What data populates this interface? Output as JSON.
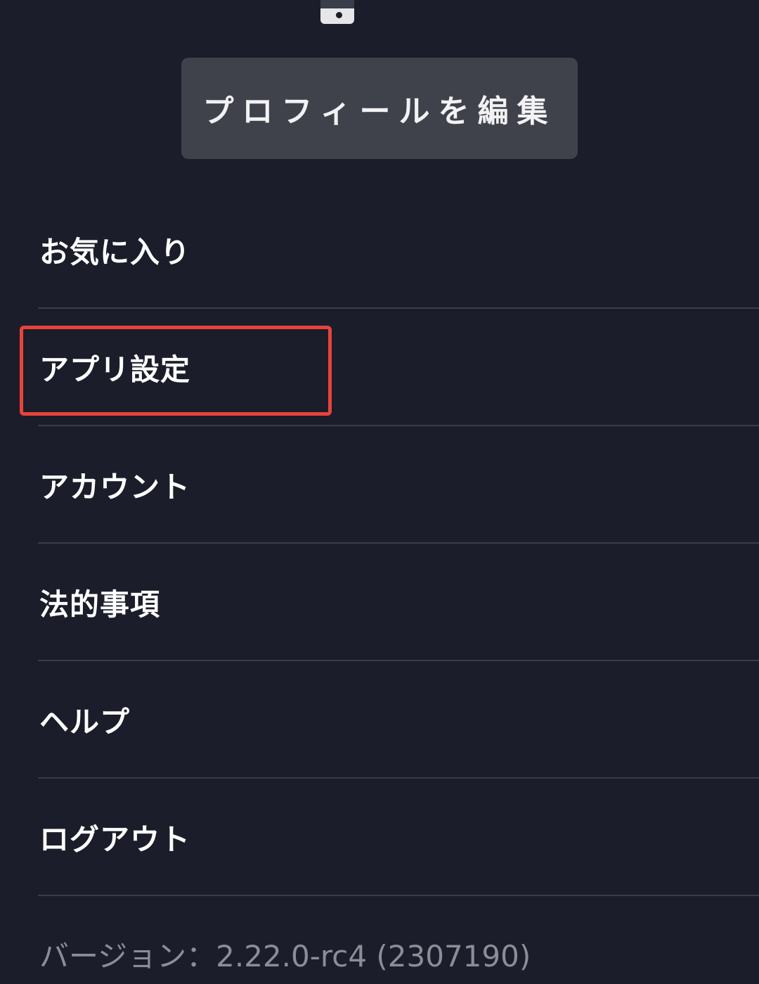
{
  "profile": {
    "edit_button_label": "プロフィールを編集"
  },
  "menu": {
    "items": [
      {
        "label": "お気に入り",
        "name": "menu-item-favorites"
      },
      {
        "label": "アプリ設定",
        "name": "menu-item-app-settings"
      },
      {
        "label": "アカウント",
        "name": "menu-item-account"
      },
      {
        "label": "法的事項",
        "name": "menu-item-legal"
      },
      {
        "label": "ヘルプ",
        "name": "menu-item-help"
      },
      {
        "label": "ログアウト",
        "name": "menu-item-logout"
      }
    ]
  },
  "footer": {
    "version_text": "バージョン：2.22.0-rc4 (2307190)"
  },
  "colors": {
    "background": "#1b1d2a",
    "button_bg": "#3f424b",
    "divider": "#3a3d49",
    "highlight": "#e8433a",
    "version_text": "#8b8d97"
  }
}
